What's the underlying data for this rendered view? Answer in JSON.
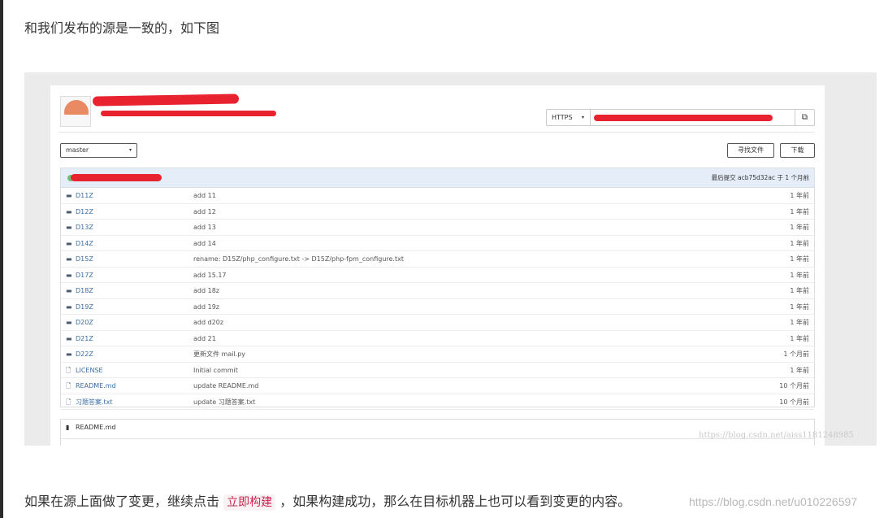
{
  "article": {
    "line1": "和我们发布的源是一致的，如下图",
    "line2_before": "如果在源上面做了变更，继续点击",
    "line2_code": "立即构建",
    "line2_after": "，如果构建成功，那么在目标机器上也可以看到变更的内容。",
    "watermark_bottom": "https://blog.csdn.net/u010226597"
  },
  "screenshot": {
    "clone": {
      "protocol": "HTTPS",
      "caret": "▾",
      "copy_icon": "copy-icon"
    },
    "branch": {
      "selected": "master",
      "caret": "▾"
    },
    "buttons": {
      "find": "寻找文件",
      "download": "下载"
    },
    "commit": {
      "label": "最后提交",
      "hash": "acb75d32ac",
      "when": "于 1 个月前"
    },
    "files": [
      {
        "type": "folder",
        "icon": "folder-icon",
        "glyph": "▬",
        "name": "D11Z",
        "message": "add 11",
        "time": "1 年前"
      },
      {
        "type": "folder",
        "icon": "folder-icon",
        "glyph": "▬",
        "name": "D12Z",
        "message": "add 12",
        "time": "1 年前"
      },
      {
        "type": "folder",
        "icon": "folder-icon",
        "glyph": "▬",
        "name": "D13Z",
        "message": "add 13",
        "time": "1 年前"
      },
      {
        "type": "folder",
        "icon": "folder-icon",
        "glyph": "▬",
        "name": "D14Z",
        "message": "add 14",
        "time": "1 年前"
      },
      {
        "type": "folder",
        "icon": "folder-icon",
        "glyph": "▬",
        "name": "D15Z",
        "message": "rename: D15Z/php_configure.txt -> D15Z/php-fpm_configure.txt",
        "time": "1 年前"
      },
      {
        "type": "folder",
        "icon": "folder-icon",
        "glyph": "▬",
        "name": "D17Z",
        "message": "add 15.17",
        "time": "1 年前"
      },
      {
        "type": "folder",
        "icon": "folder-icon",
        "glyph": "▬",
        "name": "D18Z",
        "message": "add 18z",
        "time": "1 年前"
      },
      {
        "type": "folder",
        "icon": "folder-icon",
        "glyph": "▬",
        "name": "D19Z",
        "message": "add 19z",
        "time": "1 年前"
      },
      {
        "type": "folder",
        "icon": "folder-icon",
        "glyph": "▬",
        "name": "D20Z",
        "message": "add d20z",
        "time": "1 年前"
      },
      {
        "type": "folder",
        "icon": "folder-icon",
        "glyph": "▬",
        "name": "D21Z",
        "message": "add 21",
        "time": "1 年前"
      },
      {
        "type": "folder",
        "icon": "folder-icon",
        "glyph": "▬",
        "name": "D22Z",
        "message": "更新文件 mail.py",
        "time": "1 个月前"
      },
      {
        "type": "file",
        "icon": "file-icon",
        "glyph": "🗋",
        "name": "LICENSE",
        "message": "Initial commit",
        "time": "1 年前"
      },
      {
        "type": "file",
        "icon": "file-icon",
        "glyph": "🗋",
        "name": "README.md",
        "message": "update README.md",
        "time": "10 个月前"
      },
      {
        "type": "file",
        "icon": "file-icon",
        "glyph": "🗋",
        "name": "习题答案.txt",
        "message": "update 习题答案.txt",
        "time": "10 个月前"
      }
    ],
    "readme": {
      "title": "README.md",
      "icon": "book-icon"
    },
    "watermark": "https://blog.csdn.net/aiss1181248985"
  }
}
